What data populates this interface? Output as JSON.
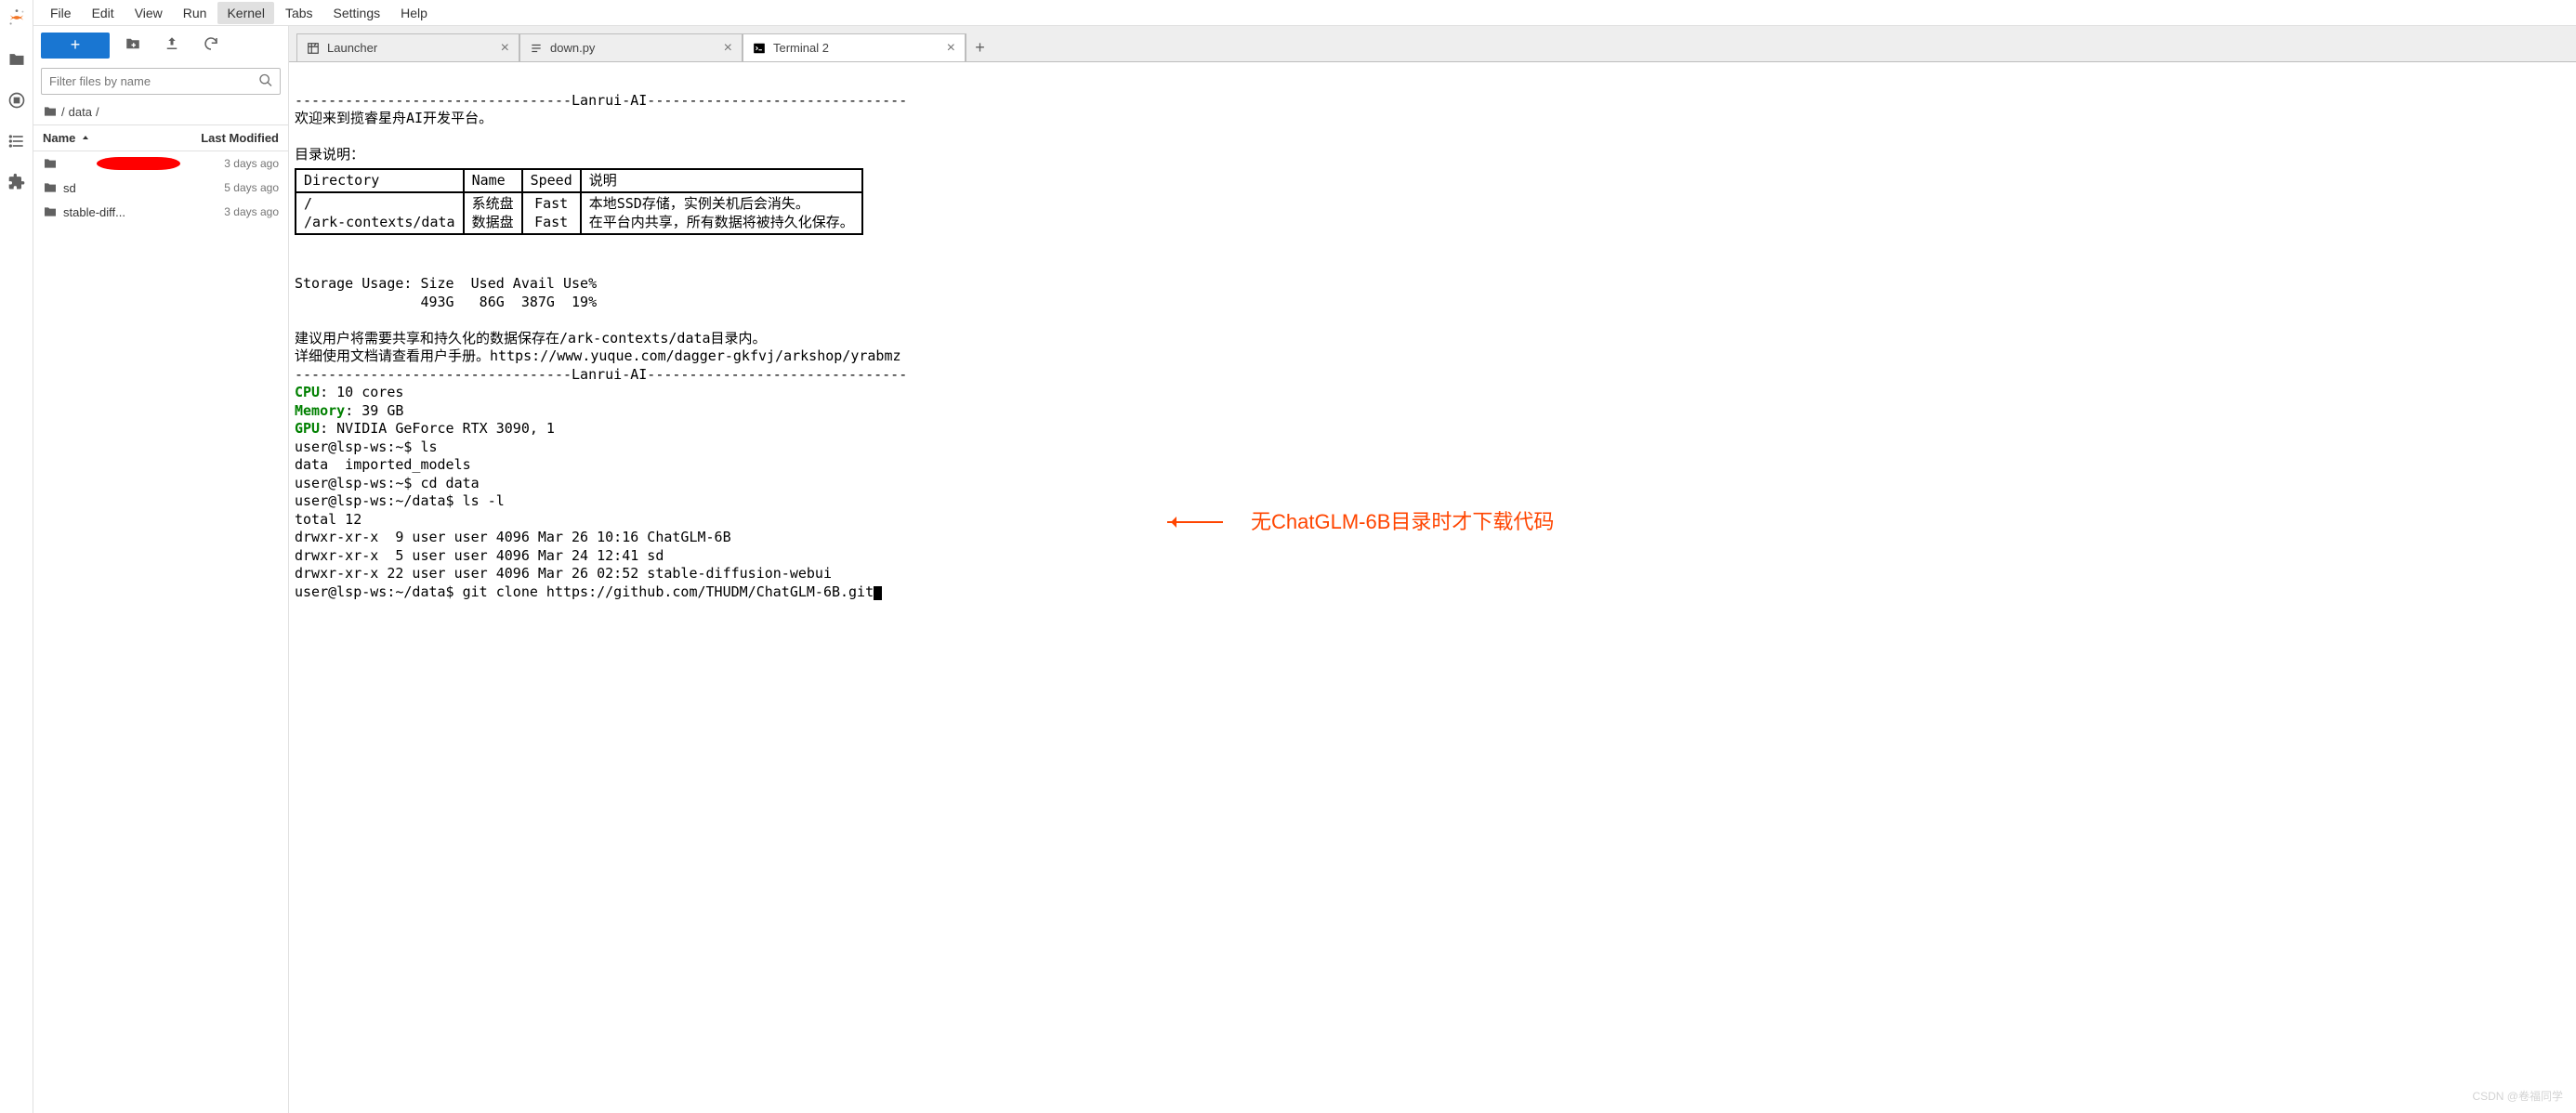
{
  "menu": {
    "items": [
      "File",
      "Edit",
      "View",
      "Run",
      "Kernel",
      "Tabs",
      "Settings",
      "Help"
    ],
    "highlighted_index": 4
  },
  "file_toolbar": {},
  "filter": {
    "placeholder": "Filter files by name"
  },
  "breadcrumb": {
    "sep1": "/",
    "folder": "data",
    "sep2": "/"
  },
  "list_header": {
    "name": "Name",
    "modified": "Last Modified"
  },
  "files": [
    {
      "name": "",
      "time": "3 days ago",
      "redacted": true
    },
    {
      "name": "sd",
      "time": "5 days ago"
    },
    {
      "name": "stable-diff...",
      "time": "3 days ago"
    }
  ],
  "tabs": [
    {
      "label": "Launcher",
      "icon": "launcher"
    },
    {
      "label": "down.py",
      "icon": "python"
    },
    {
      "label": "Terminal 2",
      "icon": "terminal",
      "active": true
    }
  ],
  "terminal": {
    "banner_line": "---------------------------------Lanrui-AI-------------------------------",
    "welcome": "欢迎来到揽睿星舟AI开发平台。",
    "dir_header": "目录说明：",
    "table": {
      "headers": [
        "Directory",
        "Name",
        "Speed",
        "说明"
      ],
      "rows": [
        [
          "/\n/ark-contexts/data",
          "系统盘\n数据盘",
          "Fast\nFast",
          "本地SSD存储，实例关机后会消失。\n在平台内共享，所有数据将被持久化保存。"
        ]
      ]
    },
    "storage": "Storage Usage: Size  Used Avail Use%\n               493G   86G  387G  19%",
    "advice1": "建议用户将需要共享和持久化的数据保存在/ark-contexts/data目录内。",
    "advice2": "详细使用文档请查看用户手册。https://www.yuque.com/dagger-gkfvj/arkshop/yrabmz",
    "banner_line2": "---------------------------------Lanrui-AI-------------------------------",
    "cpu_label": "CPU",
    "cpu_val": ": 10 cores",
    "mem_label": "Memory",
    "mem_val": ": 39 GB",
    "gpu_label": "GPU",
    "gpu_val": ": NVIDIA GeForce RTX 3090, 1",
    "shell": "user@lsp-ws:~$ ls\ndata  imported_models\nuser@lsp-ws:~$ cd data\nuser@lsp-ws:~/data$ ls -l\ntotal 12\ndrwxr-xr-x  9 user user 4096 Mar 26 10:16 ChatGLM-6B\ndrwxr-xr-x  5 user user 4096 Mar 24 12:41 sd\ndrwxr-xr-x 22 user user 4096 Mar 26 02:52 stable-diffusion-webui\nuser@lsp-ws:~/data$ git clone https://github.com/THUDM/ChatGLM-6B.git"
  },
  "annotation": "无ChatGLM-6B目录时才下载代码",
  "watermark": "CSDN @卷福同学"
}
